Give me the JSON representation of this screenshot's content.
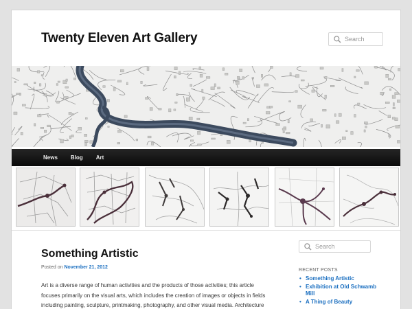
{
  "site": {
    "title": "Twenty Eleven Art Gallery"
  },
  "header_search": {
    "placeholder": "Search",
    "icon": "search-icon"
  },
  "nav": {
    "items": [
      {
        "label": "News"
      },
      {
        "label": "Blog"
      },
      {
        "label": "Art"
      }
    ]
  },
  "post": {
    "title": "Something Artistic",
    "posted_prefix": "Posted on",
    "date": "November 21, 2012",
    "excerpt": "Art is a diverse range of human activities and the products of those activities; this article focuses primarily on the visual arts, which includes the creation of images or objects in fields including painting, sculpture, printmaking, photography, and other visual media. Architecture"
  },
  "sidebar": {
    "search_placeholder": "Search",
    "recent_heading": "RECENT POSTS",
    "recent_posts": [
      {
        "title": "Something Artistic"
      },
      {
        "title": "Exhibition at Old Schwamb Mill"
      },
      {
        "title": "A Thing of Beauty"
      }
    ]
  },
  "colors": {
    "link": "#1b6fc0",
    "nav_bg": "#1a1a1a",
    "page_bg": "#e2e2e2",
    "river": "#3c4a5e",
    "ink": "#4a2f3a"
  }
}
